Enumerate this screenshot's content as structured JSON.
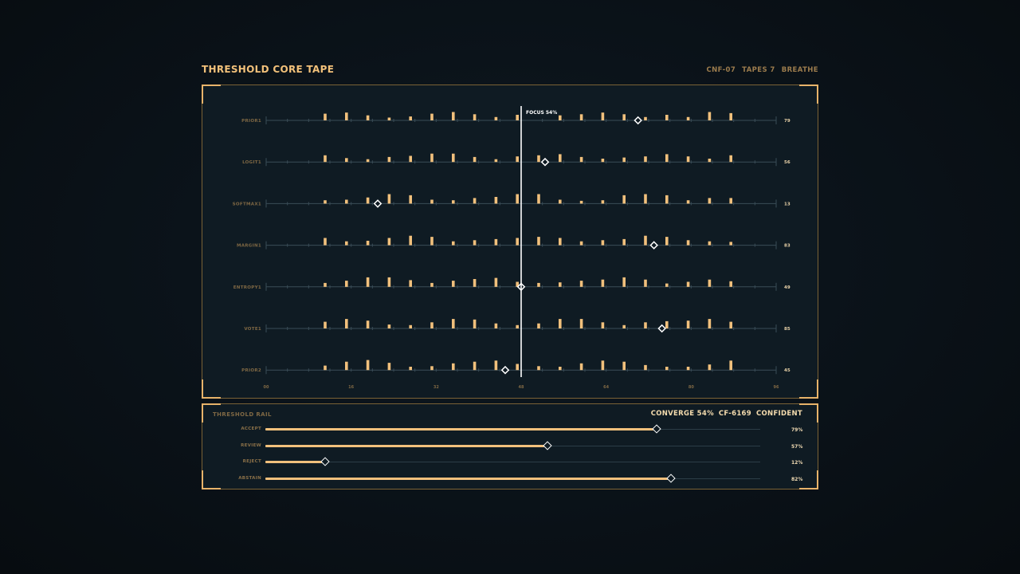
{
  "header": {
    "title": "THRESHOLD CORE TAPE",
    "meta": [
      "CNF-07",
      "TAPES 7",
      "BREATHE"
    ]
  },
  "tape": {
    "focus_label": "FOCUS 54%",
    "focus_tick": 48,
    "axis_ticks": [
      "00",
      "16",
      "32",
      "48",
      "64",
      "80",
      "96"
    ],
    "axis_max": 96,
    "colors": {
      "bar": "#f1c07c",
      "focus": "#ffffff",
      "axis": "#3a4c57",
      "label": "#7f6844"
    },
    "rows": [
      {
        "label": "PRIOR1",
        "value": "79",
        "marker": 70,
        "bars": [
          0.6,
          0.7,
          0.45,
          0.25,
          0.35,
          0.6,
          0.75,
          0.55,
          0.3,
          0.5,
          0,
          0.45,
          0.55,
          0.7,
          0.55,
          0.3,
          0.5,
          0.3,
          0.75,
          0.65
        ]
      },
      {
        "label": "LOGIT1",
        "value": "56",
        "marker": 52.5,
        "bars": [
          0.6,
          0.35,
          0.25,
          0.45,
          0.55,
          0.75,
          0.75,
          0.45,
          0.25,
          0.5,
          0.6,
          0.7,
          0.45,
          0.3,
          0.4,
          0.5,
          0.7,
          0.5,
          0.3,
          0.6
        ]
      },
      {
        "label": "SOFTMAX1",
        "value": "13",
        "marker": 21,
        "bars": [
          0.3,
          0.35,
          0.55,
          0.85,
          0.75,
          0.35,
          0.3,
          0.5,
          0.6,
          0.85,
          0.85,
          0.35,
          0.25,
          0.3,
          0.75,
          0.85,
          0.75,
          0.3,
          0.5,
          0.5
        ]
      },
      {
        "label": "MARGIN1",
        "value": "83",
        "marker": 73,
        "bars": [
          0.65,
          0.35,
          0.4,
          0.65,
          0.85,
          0.75,
          0.35,
          0.45,
          0.55,
          0.65,
          0.75,
          0.65,
          0.35,
          0.45,
          0.55,
          0.85,
          0.75,
          0.45,
          0.35,
          0.3
        ]
      },
      {
        "label": "ENTROPY1",
        "value": "49",
        "marker": 48,
        "bars": [
          0.35,
          0.55,
          0.85,
          0.85,
          0.6,
          0.35,
          0.55,
          0.7,
          0.8,
          0.45,
          0.35,
          0.4,
          0.55,
          0.65,
          0.85,
          0.65,
          0.3,
          0.45,
          0.65,
          0.5
        ]
      },
      {
        "label": "VOTE1",
        "value": "85",
        "marker": 74.5,
        "bars": [
          0.6,
          0.85,
          0.7,
          0.35,
          0.3,
          0.55,
          0.85,
          0.8,
          0.45,
          0.3,
          0.45,
          0.85,
          0.85,
          0.55,
          0.3,
          0.55,
          0.65,
          0.7,
          0.85,
          0.6
        ]
      },
      {
        "label": "PRIOR2",
        "value": "45",
        "marker": 45,
        "bars": [
          0.4,
          0.75,
          0.9,
          0.65,
          0.3,
          0.35,
          0.6,
          0.75,
          0.85,
          0.55,
          0.35,
          0.3,
          0.6,
          0.85,
          0.75,
          0.45,
          0.3,
          0.3,
          0.5,
          0.85
        ]
      }
    ]
  },
  "rail": {
    "title": "THRESHOLD RAIL",
    "status": [
      "CONVERGE 54%",
      "CF-6169",
      "CONFIDENT"
    ],
    "rows": [
      {
        "label": "ACCEPT",
        "value": "79%",
        "level": 0.79
      },
      {
        "label": "REVIEW",
        "value": "57%",
        "level": 0.57
      },
      {
        "label": "REJECT",
        "value": "12%",
        "level": 0.12
      },
      {
        "label": "ABSTAIN",
        "value": "82%",
        "level": 0.82
      }
    ]
  }
}
